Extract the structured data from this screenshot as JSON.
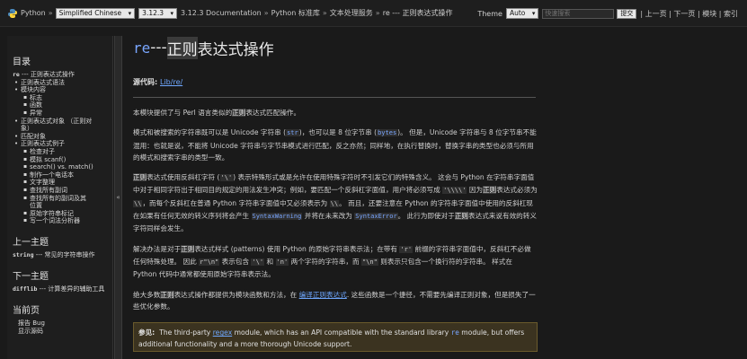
{
  "topbar": {
    "site": "Python",
    "language": "Simplified Chinese",
    "version": "3.12.3",
    "crumbs": [
      "3.12.3 Documentation",
      "Python 标准库",
      "文本处理服务",
      "re --- 正则表达式操作"
    ],
    "crumb_sep": "»",
    "theme_label": "Theme",
    "theme_value": "Auto",
    "search_placeholder": "快速搜索",
    "go_label": "提交",
    "nav": [
      "上一页",
      "下一页",
      "模块",
      "索引"
    ]
  },
  "sidebar": {
    "toc_heading": "目录",
    "toc": [
      {
        "level": 0,
        "code": "re",
        "text": " --- 正则表达式操作"
      },
      {
        "level": 1,
        "text": "正则表达式语法"
      },
      {
        "level": 1,
        "text": "模块内容"
      },
      {
        "level": 2,
        "text": "标志"
      },
      {
        "level": 2,
        "text": "函数"
      },
      {
        "level": 2,
        "text": "异常"
      },
      {
        "level": 1,
        "text": "正则表达式对象 （正则对"
      },
      {
        "level": 1,
        "text": "象）",
        "cont": true
      },
      {
        "level": 1,
        "text": "匹配对象"
      },
      {
        "level": 1,
        "text": "正则表达式例子"
      },
      {
        "level": 2,
        "text": "检查对子"
      },
      {
        "level": 2,
        "text": "模拟 scanf()"
      },
      {
        "level": 2,
        "text": "search() vs. match()"
      },
      {
        "level": 2,
        "text": "制作一个电话本"
      },
      {
        "level": 2,
        "text": "文字整理"
      },
      {
        "level": 2,
        "text": "查找所有副词"
      },
      {
        "level": 2,
        "text": "查找所有的副词及其"
      },
      {
        "level": 2,
        "text": "位置",
        "cont": true
      },
      {
        "level": 2,
        "text": "原始字符串标记"
      },
      {
        "level": 2,
        "text": "写一个词法分析器"
      }
    ],
    "prev_heading": "上一主题",
    "prev_code": "string",
    "prev_text": " --- 常见的字符串操作",
    "next_heading": "下一主题",
    "next_code": "difflib",
    "next_text": " --- 计算差异的辅助工具",
    "next_text2": "具",
    "page_heading": "当前页",
    "page_link1": "报告 Bug",
    "page_link2": "显示源码"
  },
  "collapse_glyph": "«",
  "main": {
    "title_code": "re",
    "title_dash": " --- ",
    "title_hl": "正则",
    "title_rest": "表达式操作",
    "source_label": "源代码:",
    "source_link": "Lib/re/",
    "p1a": "本模块提供了与 Perl 语言类似的",
    "p1hl": "正则",
    "p1b": "表达式匹配操作。",
    "p2": {
      "a": "模式和被搜索的字符串既可以是 Unicode 字符串 (",
      "c1": "str",
      "b": ")，也可以是 8 位字节串 (",
      "c2": "bytes",
      "c": ")。 但是，Unicode 字符串与 8 位字节串不能混用：也就是说，不能将 Unicode 字符串与字节串模式进行匹配，反之亦然；同样地，在执行替换时，替换字串的类型也必须与所用的模式和搜索字串的类型一致。"
    },
    "p3": {
      "hl": "正则",
      "a": "表达式使用反斜杠字符 (",
      "c1": "'\\'",
      "b": ") 表示特殊形式或是允许在使用特殊字符时不引发它们的特殊含义。 这会与 Python 在字符串字面值中对于相同字符出于相同目的规定的用法发生冲突；例如，要匹配一个反斜杠字面值，用户将必须写成 ",
      "c2": "'\\\\\\\\'",
      "c": " 因为",
      "hl2": "正则",
      "d": "表达式必须为 ",
      "c3": "\\\\",
      "e": "，而每个反斜杠在普通 Python 字符串字面值中又必须表示为 ",
      "c4": "\\\\",
      "f": "。 而且，还要注意在 Python 的字符串字面值中使用的反斜杠现在如果有任何无效的转义序列将会产生 ",
      "c5": "SyntaxWarning",
      "g": " 并将在未来改为 ",
      "c6": "SyntaxError",
      "h": "。 此行为即使对于",
      "hl3": "正则",
      "i": "表达式来说有效的转义字符同样会发生。"
    },
    "p4": {
      "a": "解决办法是对于",
      "hl": "正则",
      "b": "表达式样式 (patterns) 使用 Python 的原始字符串表示法；在带有 ",
      "c1": "'r'",
      "c": " 前缀的字符串字面值中，反斜杠不必做任何特殊处理。 因此 ",
      "c2": "r\"\\n\"",
      "d": " 表示包含 ",
      "c3": "'\\'",
      "e": " 和 ",
      "c4": "'n'",
      "f": " 两个字符的字符串，而 ",
      "c5": "\"\\n\"",
      "g": " 则表示只包含一个换行符的字符串。 样式在 Python 代码中通常都使用原始字符串表示法。"
    },
    "p5": {
      "a": "绝大多数",
      "hl": "正则",
      "b": "表达式操作都提供为模块函数和方法，在 ",
      "link": "编译正则表达式",
      "c": ". 这些函数是一个捷径，不需要先编译正则对象，但是损失了一些优化参数。"
    },
    "note": {
      "label": "参见:",
      "a": "The third-party ",
      "link": "regex",
      "b": " module, which has an API compatible with the standard library ",
      "code": "re",
      "c": " module, but offers additional functionality and a more thorough Unicode support."
    }
  },
  "colors": {
    "background": "#1a1a1a",
    "link": "#6fa8ff",
    "code": "#79a6ff",
    "note_bg": "#3b3320"
  }
}
